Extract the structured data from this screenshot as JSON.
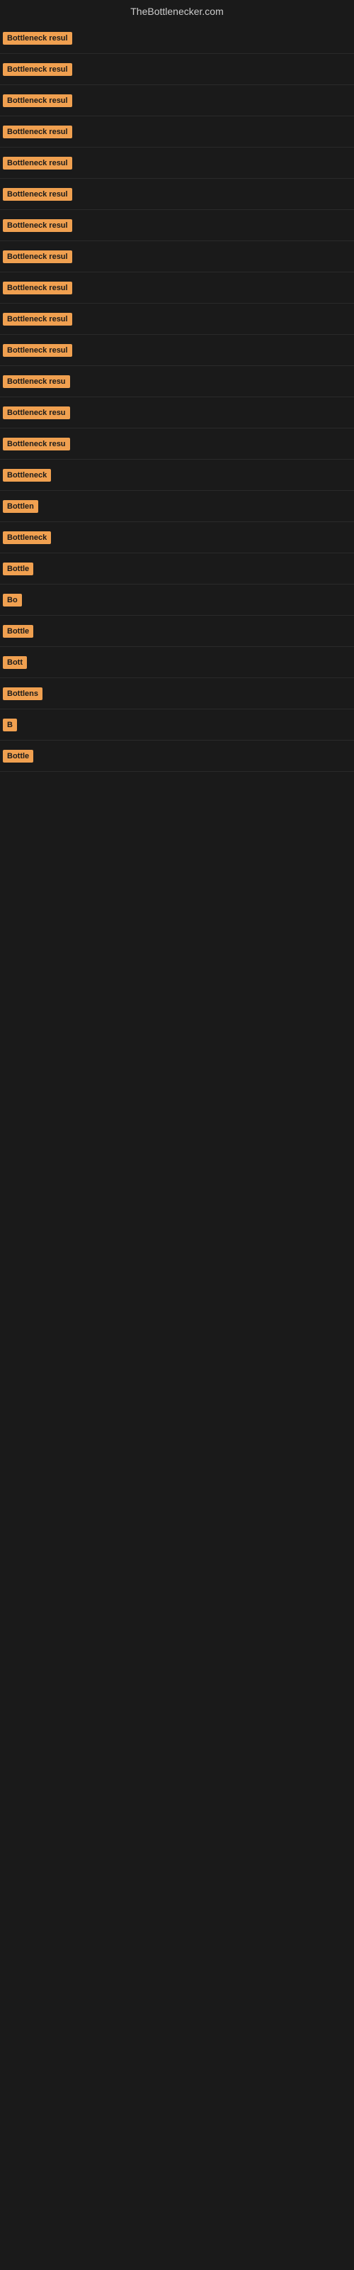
{
  "site": {
    "title": "TheBottlenecker.com"
  },
  "rows": [
    {
      "id": 1,
      "label": "Bottleneck result",
      "visible_chars": 16
    },
    {
      "id": 2,
      "label": "Bottleneck result",
      "visible_chars": 16
    },
    {
      "id": 3,
      "label": "Bottleneck result",
      "visible_chars": 16
    },
    {
      "id": 4,
      "label": "Bottleneck result",
      "visible_chars": 16
    },
    {
      "id": 5,
      "label": "Bottleneck result",
      "visible_chars": 16
    },
    {
      "id": 6,
      "label": "Bottleneck result",
      "visible_chars": 16
    },
    {
      "id": 7,
      "label": "Bottleneck result",
      "visible_chars": 16
    },
    {
      "id": 8,
      "label": "Bottleneck result",
      "visible_chars": 16
    },
    {
      "id": 9,
      "label": "Bottleneck result",
      "visible_chars": 16
    },
    {
      "id": 10,
      "label": "Bottleneck result",
      "visible_chars": 16
    },
    {
      "id": 11,
      "label": "Bottleneck result",
      "visible_chars": 16
    },
    {
      "id": 12,
      "label": "Bottleneck resu",
      "visible_chars": 15
    },
    {
      "id": 13,
      "label": "Bottleneck result",
      "visible_chars": 15
    },
    {
      "id": 14,
      "label": "Bottleneck resu",
      "visible_chars": 15
    },
    {
      "id": 15,
      "label": "Bottleneck r",
      "visible_chars": 11
    },
    {
      "id": 16,
      "label": "Bottlen",
      "visible_chars": 7
    },
    {
      "id": 17,
      "label": "Bottleneck",
      "visible_chars": 10
    },
    {
      "id": 18,
      "label": "Bottle",
      "visible_chars": 6
    },
    {
      "id": 19,
      "label": "Bo",
      "visible_chars": 2
    },
    {
      "id": 20,
      "label": "Bottle",
      "visible_chars": 6
    },
    {
      "id": 21,
      "label": "Bott",
      "visible_chars": 4
    },
    {
      "id": 22,
      "label": "Bottlens",
      "visible_chars": 8
    },
    {
      "id": 23,
      "label": "B",
      "visible_chars": 1
    },
    {
      "id": 24,
      "label": "Bottle",
      "visible_chars": 6
    }
  ],
  "colors": {
    "badge_bg": "#f0a050",
    "badge_text": "#1a1a1a",
    "page_bg": "#1a1a1a",
    "title_text": "#cccccc"
  }
}
